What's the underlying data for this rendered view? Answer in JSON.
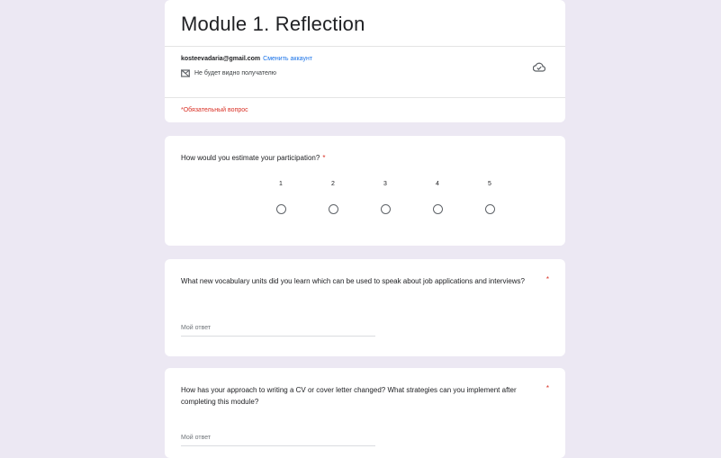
{
  "form": {
    "title": "Module 1. Reflection",
    "account_email": "kosteevadaria@gmail.com",
    "switch_account": "Сменить аккаунт",
    "no_email_notice": "Не будет видно получателю",
    "required_note": "*Обязательный вопрос"
  },
  "icons": {
    "cloud": "cloud-check-icon",
    "no_email": "no-email-icon"
  },
  "colors": {
    "background": "#ece8f3",
    "required": "#d93025",
    "link": "#1a73e8"
  },
  "questions": [
    {
      "text": "How would you estimate your participation?",
      "required_mark": "*",
      "scale": [
        "1",
        "2",
        "3",
        "4",
        "5"
      ]
    },
    {
      "text": "What new vocabulary units did you learn which can be used to speak about job applications and interviews?",
      "required_mark": "*",
      "answer_placeholder": "Мой ответ"
    },
    {
      "text": "How has your approach to writing a CV or cover letter changed? What strategies can you implement after completing this module?",
      "required_mark": "*",
      "answer_placeholder": "Мой ответ"
    }
  ]
}
